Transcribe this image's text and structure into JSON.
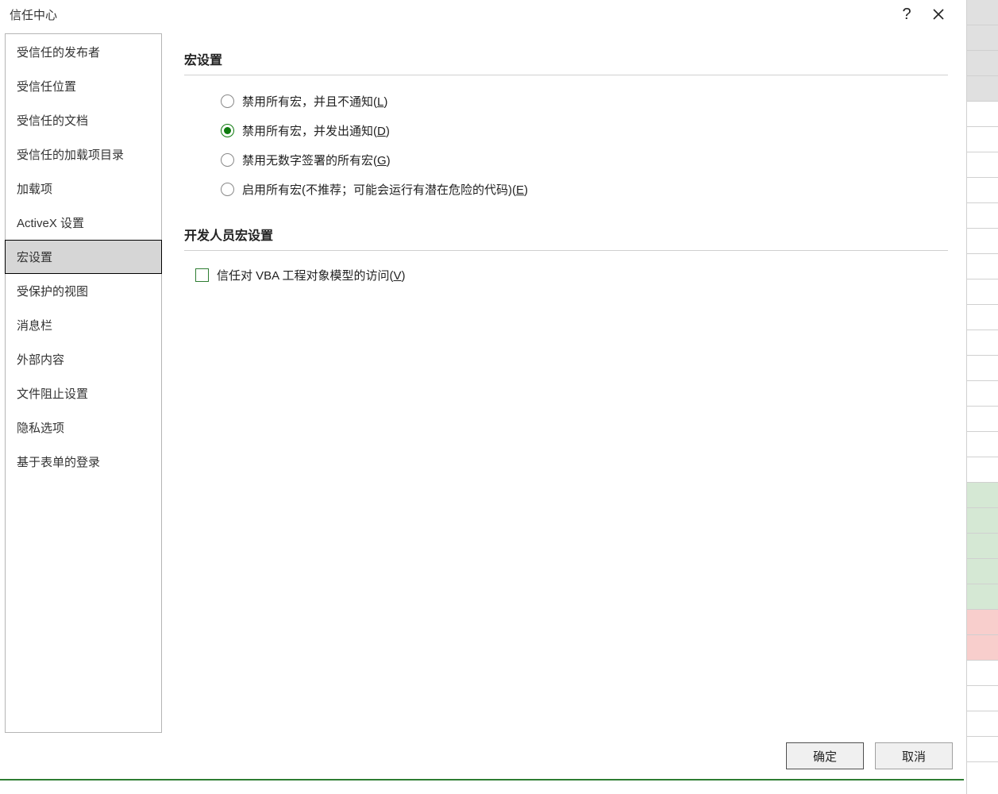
{
  "titlebar": {
    "title": "信任中心",
    "help": "?",
    "close": "×"
  },
  "sidebar": {
    "items": [
      {
        "label": "受信任的发布者",
        "selected": false
      },
      {
        "label": "受信任位置",
        "selected": false
      },
      {
        "label": "受信任的文档",
        "selected": false
      },
      {
        "label": "受信任的加载项目录",
        "selected": false
      },
      {
        "label": "加载项",
        "selected": false
      },
      {
        "label": "ActiveX 设置",
        "selected": false
      },
      {
        "label": "宏设置",
        "selected": true
      },
      {
        "label": "受保护的视图",
        "selected": false
      },
      {
        "label": "消息栏",
        "selected": false
      },
      {
        "label": "外部内容",
        "selected": false
      },
      {
        "label": "文件阻止设置",
        "selected": false
      },
      {
        "label": "隐私选项",
        "selected": false
      },
      {
        "label": "基于表单的登录",
        "selected": false
      }
    ]
  },
  "content": {
    "section1_title": "宏设置",
    "radios": [
      {
        "pre": "禁用所有宏，并且不通知(",
        "key": "L",
        "post": ")",
        "checked": false
      },
      {
        "pre": "禁用所有宏，并发出通知(",
        "key": "D",
        "post": ")",
        "checked": true
      },
      {
        "pre": "禁用无数字签署的所有宏(",
        "key": "G",
        "post": ")",
        "checked": false
      },
      {
        "pre": "启用所有宏(不推荐；可能会运行有潜在危险的代码)(",
        "key": "E",
        "post": ")",
        "checked": false
      }
    ],
    "section2_title": "开发人员宏设置",
    "checkbox": {
      "pre": "信任对 VBA 工程对象模型的访问(",
      "key": "V",
      "post": ")",
      "checked": false
    }
  },
  "footer": {
    "ok": "确定",
    "cancel": "取消"
  }
}
